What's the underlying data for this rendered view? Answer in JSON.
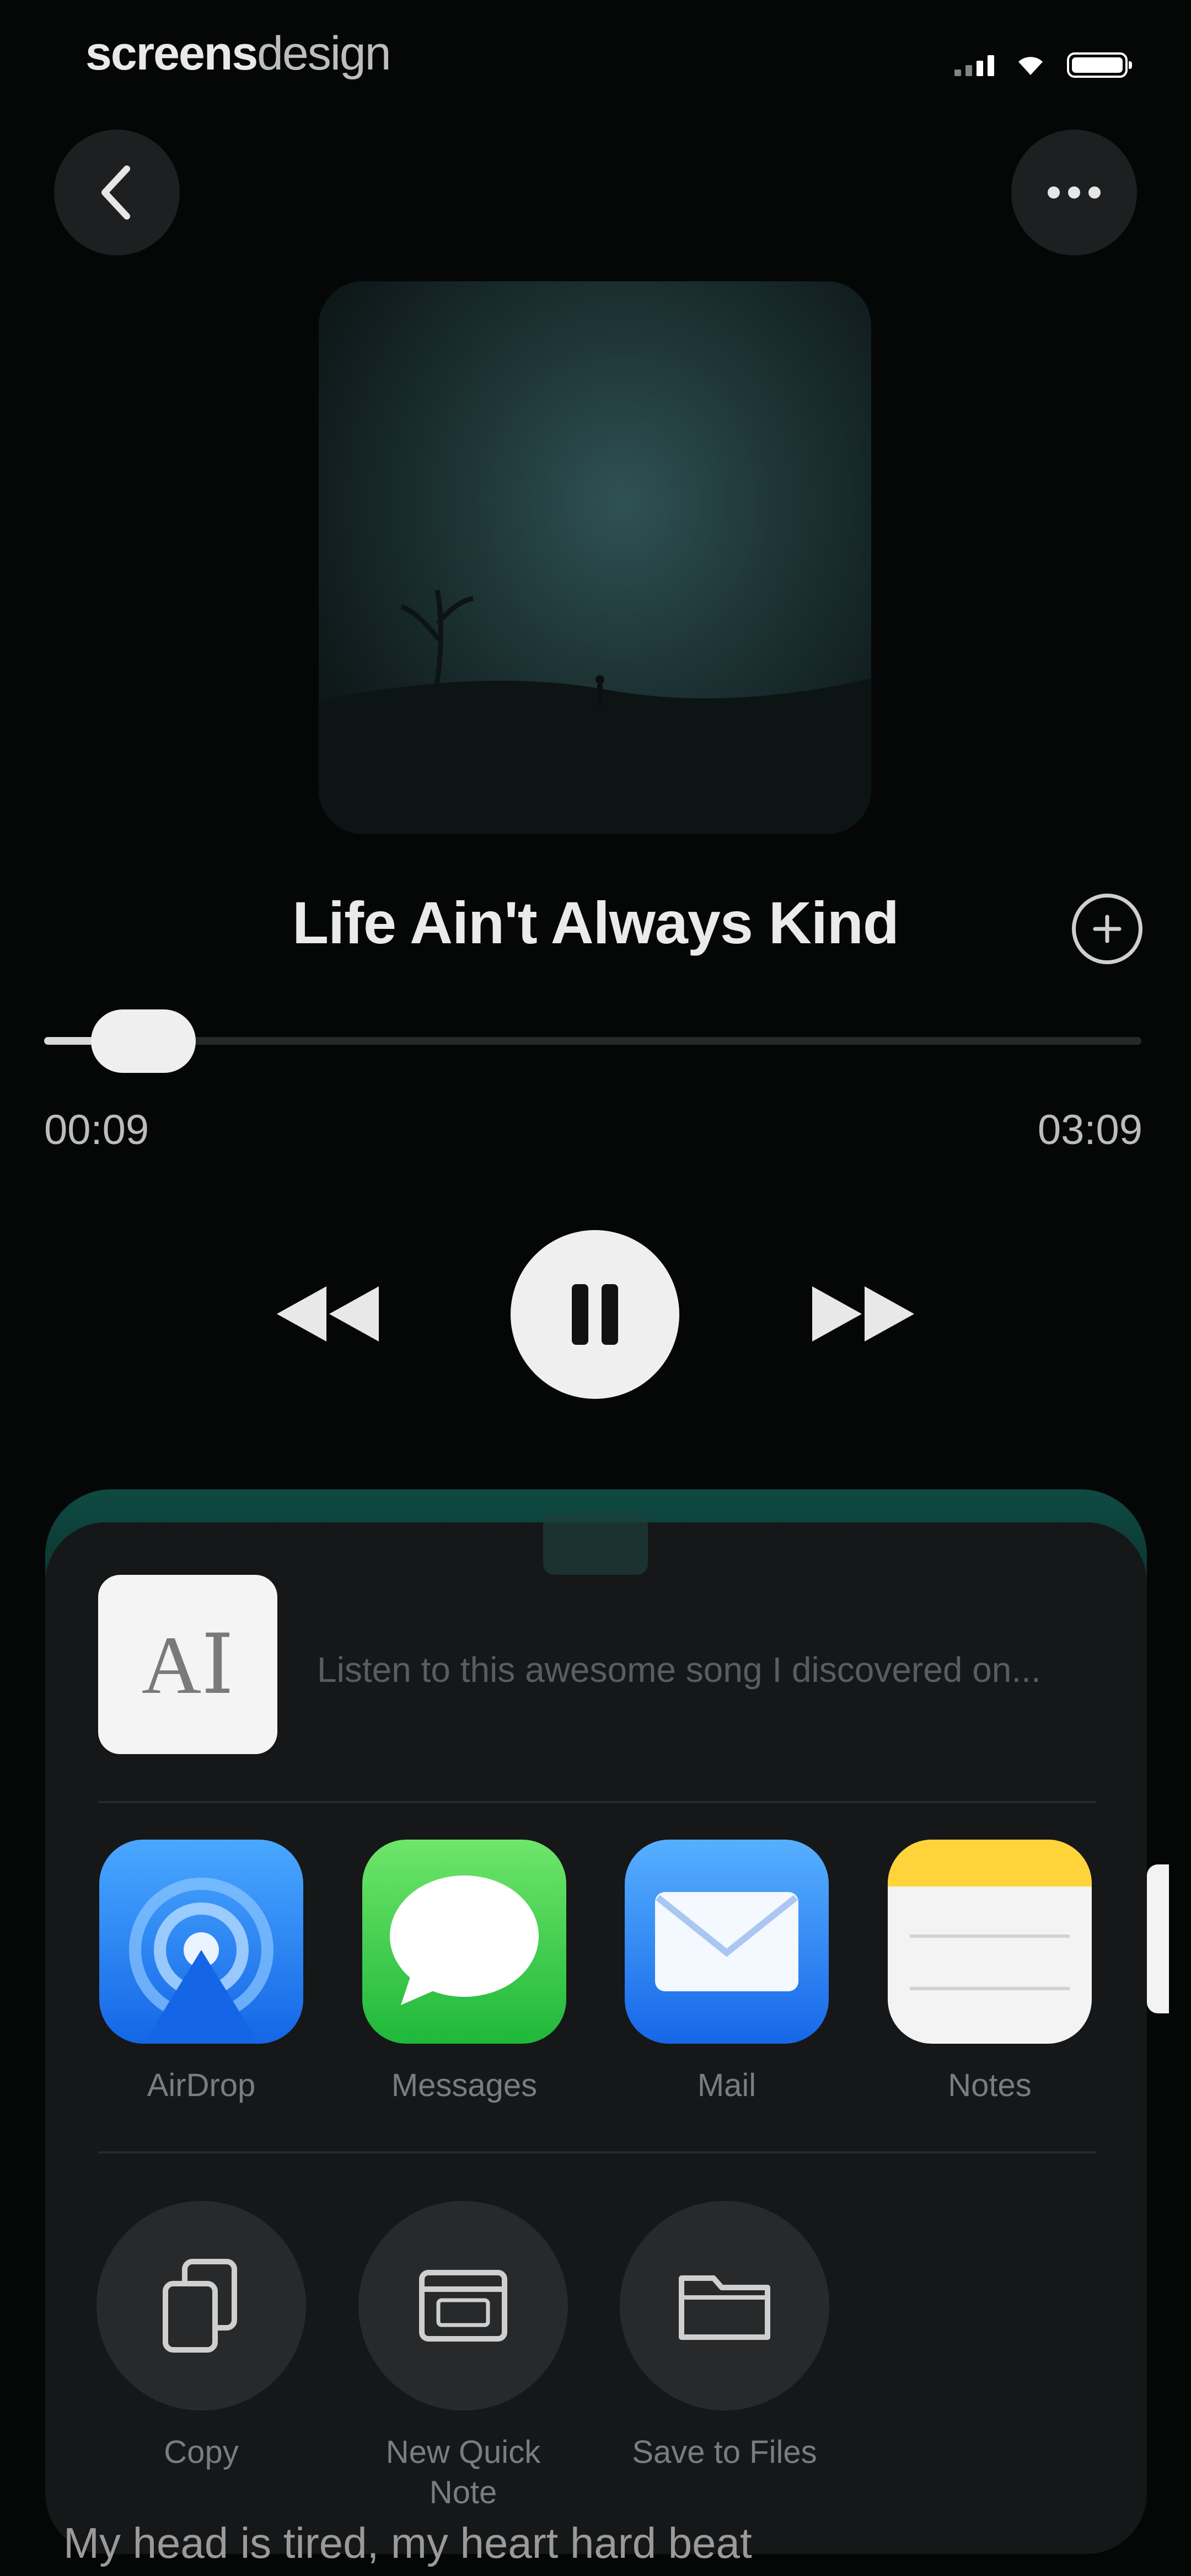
{
  "brand": {
    "bold": "screens",
    "light": "design"
  },
  "player": {
    "song_title": "Life Ain't Always Kind",
    "elapsed": "00:09",
    "duration": "03:09",
    "progress": 0.05
  },
  "share_sheet": {
    "message_preview": "Listen to this awesome song I discovered on...",
    "apps": [
      {
        "label": "AirDrop",
        "icon": "airdrop-icon"
      },
      {
        "label": "Messages",
        "icon": "messages-icon"
      },
      {
        "label": "Mail",
        "icon": "mail-icon"
      },
      {
        "label": "Notes",
        "icon": "notes-icon"
      }
    ],
    "actions": [
      {
        "label": "Copy",
        "icon": "copy-icon"
      },
      {
        "label": "New Quick Note",
        "icon": "quick-note-icon"
      },
      {
        "label": "Save to Files",
        "icon": "folder-icon"
      }
    ]
  },
  "lyrics_peek": "My head is tired, my heart hard beat",
  "colors": {
    "background": "#050706",
    "sheet": "#161718",
    "accent_teal": "#0f4a43",
    "airdrop_blue": "#1f7df1",
    "messages_green": "#34c759",
    "mail_blue": "#2a8bf5",
    "notes_yellow": "#ffd43b"
  }
}
